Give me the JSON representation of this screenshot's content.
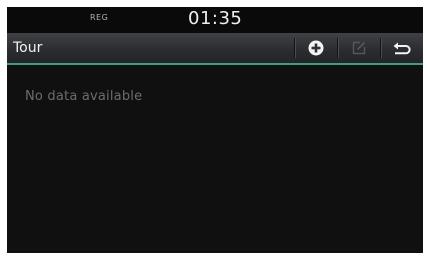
{
  "status_bar": {
    "mode_label": "REG",
    "time": "01:35"
  },
  "header": {
    "title": "Tour",
    "buttons": {
      "add": {
        "icon": "plus-circle-icon",
        "enabled": true
      },
      "edit": {
        "icon": "edit-icon",
        "enabled": false
      },
      "back": {
        "icon": "back-arrow-icon",
        "enabled": true
      }
    }
  },
  "main": {
    "empty_message": "No data available"
  },
  "colors": {
    "background": "#0f0f0f",
    "header_gradient_top": "#3f4145",
    "header_gradient_bottom": "#222325",
    "accent_line": "#3d9c88",
    "text_primary": "#f2f2f2",
    "text_muted": "#6a6c70",
    "icon_disabled": "#55575b"
  }
}
